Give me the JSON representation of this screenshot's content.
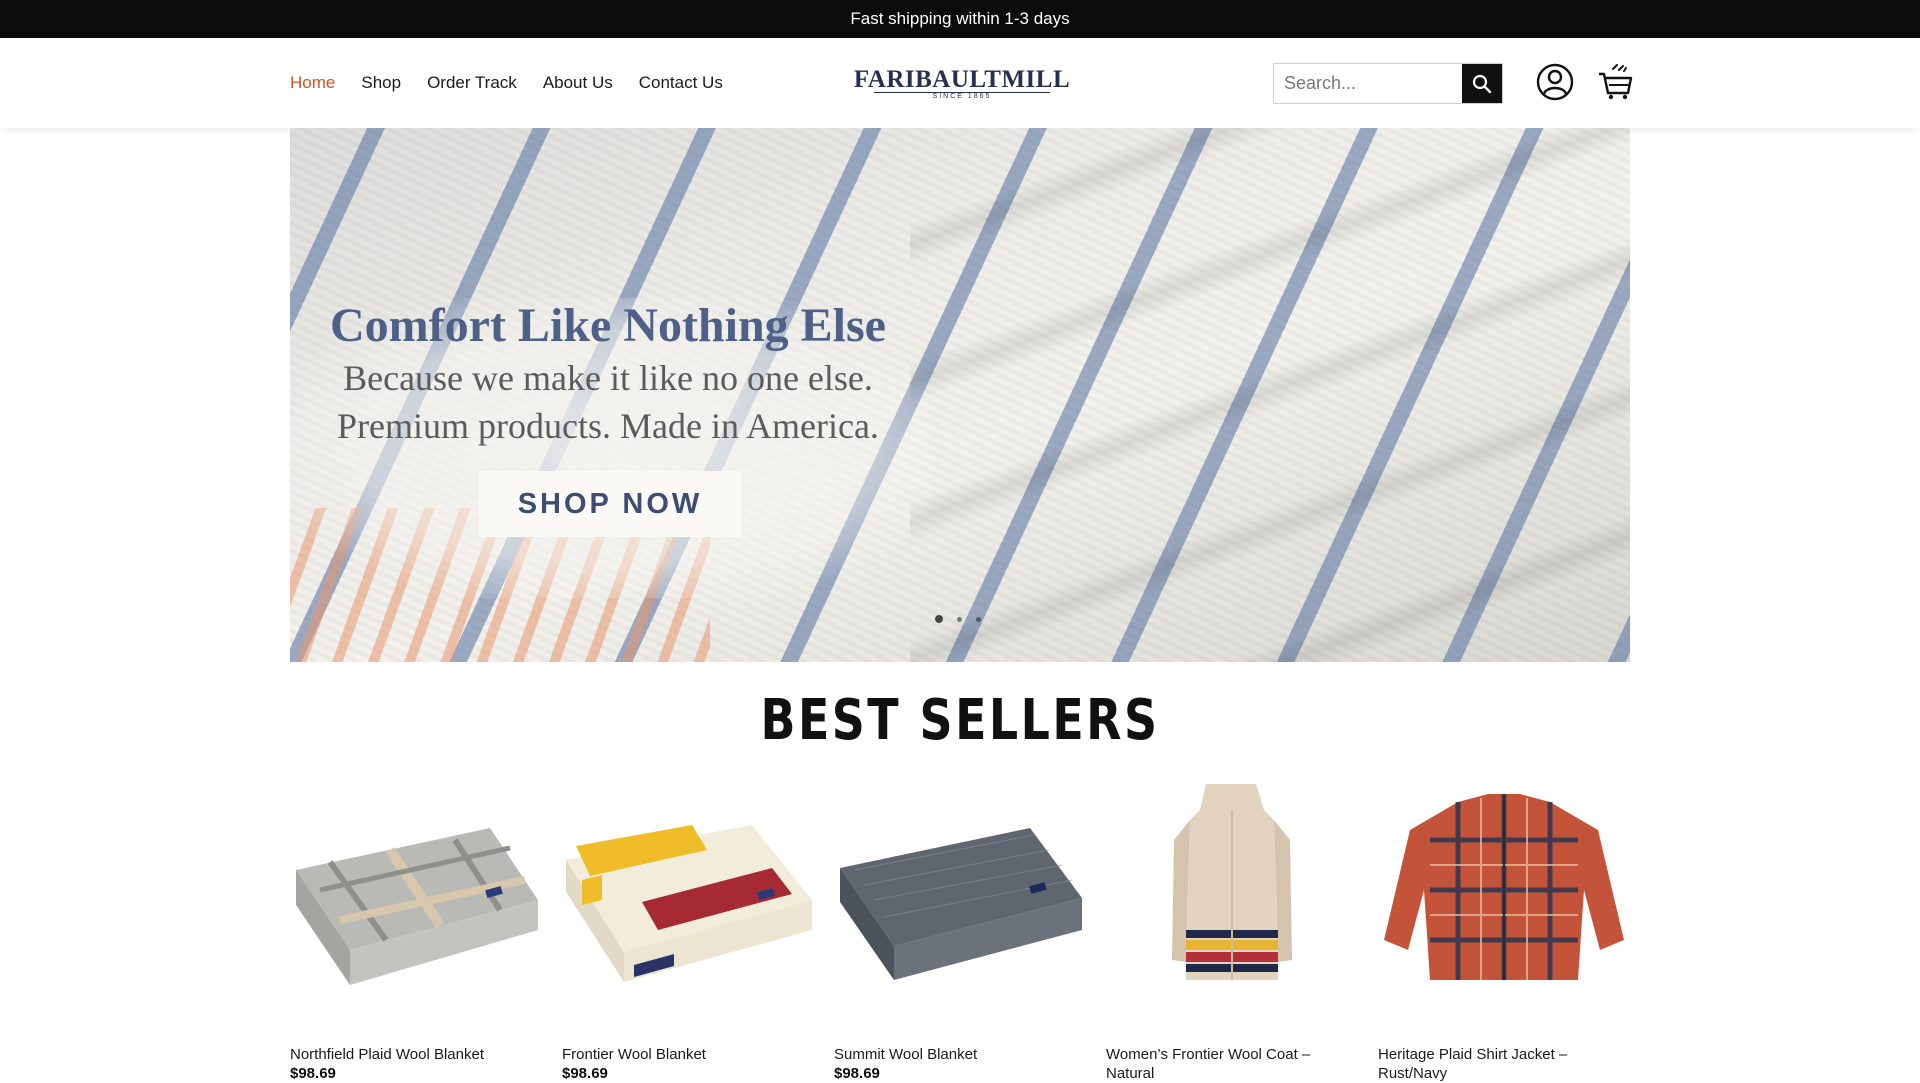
{
  "announcement": "Fast shipping within 1-3 days",
  "nav": {
    "items": [
      {
        "label": "Home",
        "active": true
      },
      {
        "label": "Shop",
        "active": false
      },
      {
        "label": "Order Track",
        "active": false
      },
      {
        "label": "About Us",
        "active": false
      },
      {
        "label": "Contact Us",
        "active": false
      }
    ]
  },
  "logo": {
    "main": "FARIBAULTMILL",
    "sub": "SINCE 1865"
  },
  "search": {
    "placeholder": "Search...",
    "icon": "search-icon"
  },
  "header_icons": {
    "account": "account-icon",
    "cart": "cart-icon"
  },
  "hero": {
    "title": "Comfort Like Nothing Else",
    "subtitle_line1": "Because we make it like no one else.",
    "subtitle_line2": "Premium products. Made in America.",
    "cta": "SHOP NOW",
    "slides": 3,
    "active_slide": 1
  },
  "best_sellers": {
    "title": "BEST SELLERS",
    "products": [
      {
        "name": "Northfield Plaid Wool Blanket",
        "price": "$98.69"
      },
      {
        "name": "Frontier Wool Blanket",
        "price": "$98.69"
      },
      {
        "name": "Summit Wool Blanket",
        "price": "$98.69"
      },
      {
        "name": "Women’s Frontier Wool Coat – Natural",
        "price": ""
      },
      {
        "name": "Heritage Plaid Shirt Jacket – Rust/Navy",
        "price": ""
      }
    ]
  },
  "colors": {
    "accent_active_nav": "#d2541d",
    "hero_title": "#4e6087",
    "brand_navy": "#27304f"
  }
}
